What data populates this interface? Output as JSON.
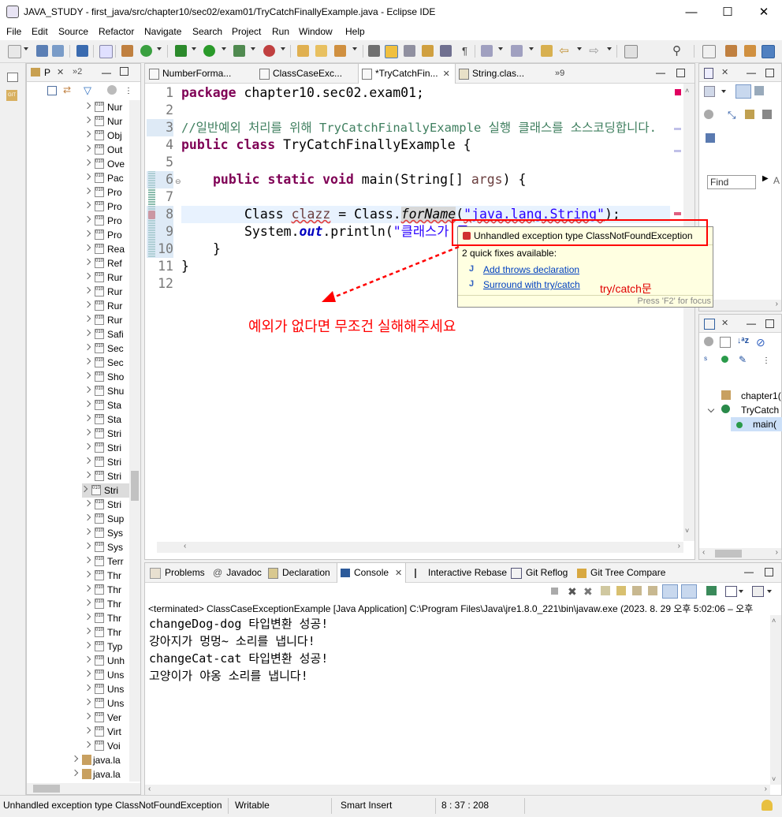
{
  "window": {
    "title": "JAVA_STUDY - first_java/src/chapter10/sec02/exam01/TryCatchFinallyExample.java - Eclipse IDE",
    "minimize": "—",
    "maximize": "☐",
    "close": "✕"
  },
  "menu": [
    "File",
    "Edit",
    "Source",
    "Refactor",
    "Navigate",
    "Search",
    "Project",
    "Run",
    "Window",
    "Help"
  ],
  "package_explorer": {
    "tab_label": "P",
    "tab2_label": "»2",
    "items": [
      "Nur",
      "Nur",
      "Obj",
      "Out",
      "Ove",
      "Pac",
      "Pro",
      "Pro",
      "Pro",
      "Pro",
      "Rea",
      "Ref",
      "Rur",
      "Rur",
      "Rur",
      "Rur",
      "Safi",
      "Sec",
      "Sec",
      "Sho",
      "Shu",
      "Sta",
      "Sta",
      "Stri",
      "Stri",
      "Stri",
      "Stri",
      "Stri",
      "Stri",
      "Sup",
      "Sys",
      "Sys",
      "Terr",
      "Thr",
      "Thr",
      "Thr",
      "Thr",
      "Thr",
      "Typ",
      "Unh",
      "Uns",
      "Uns",
      "Uns",
      "Ver",
      "Virt",
      "Voi"
    ],
    "packages": [
      "java.la",
      "java.la"
    ]
  },
  "editor": {
    "tabs": [
      "NumberForma...",
      "ClassCaseExc...",
      "*TryCatchFin...",
      "String.clas...",
      "»9"
    ],
    "active_tab": 2,
    "line_numbers": [
      "1",
      "2",
      "3",
      "4",
      "5",
      "6",
      "7",
      "8",
      "9",
      "10",
      "11",
      "12"
    ],
    "lines": {
      "l1_kw": "package",
      "l1_rest": " chapter10.sec02.exam01;",
      "l3_comment": "//일반예외 처리를 위해 TryCatchFinallyExample 실행 클래스를 소스코딩합니다.",
      "l4_kw": "public class",
      "l4_rest": " TryCatchFinallyExample {",
      "l6_kw": "public static void",
      "l6_rest1": " main(String[] ",
      "l6_var": "args",
      "l6_rest2": ") {",
      "l8_a": "Class ",
      "l8_var": "clazz",
      "l8_b": " = Class.",
      "l8_method": "forName",
      "l8_c": "(",
      "l8_str": "\"java.lang.String\"",
      "l8_d": ");",
      "l9_a": "System.",
      "l9_out": "out",
      "l9_b": ".println(",
      "l9_str": "\"클래스가 존",
      "l10": "}",
      "l11": "}"
    }
  },
  "hover_popup": {
    "title": "Unhandled exception type ClassNotFoundException",
    "subtitle": "2 quick fixes available:",
    "fixes": [
      "Add throws declaration",
      "Surround with try/catch"
    ],
    "footer": "Press 'F2' for focus"
  },
  "annotations": {
    "trycatch": "try/catch문",
    "note": "예외가 없다면 무조건 실해해주세요"
  },
  "outline": {
    "items": [
      "chapter1(",
      "TryCatch",
      "main("
    ],
    "find_placeholder": "Find",
    "all_label": "A"
  },
  "console": {
    "tabs": [
      "Problems",
      "Javadoc",
      "Declaration",
      "Console",
      "Interactive Rebase",
      "Git Reflog",
      "Git Tree Compare"
    ],
    "header": "<terminated> ClassCaseExceptionExample [Java Application] C:\\Program Files\\Java\\jre1.8.0_221\\bin\\javaw.exe  (2023. 8. 29 오후 5:02:06 – 오후",
    "lines": [
      "changeDog-dog 타입변환 성공!",
      "강아지가 멍멍~ 소리를 냅니다!",
      "changeCat-cat 타입변환 성공!",
      "고양이가 야옹 소리를 냅니다!"
    ]
  },
  "statusbar": {
    "message": "Unhandled exception type ClassNotFoundException",
    "mode": "Writable",
    "insert": "Smart Insert",
    "position": "8 : 37 : 208"
  },
  "colors": {
    "keyword": "#7f0055",
    "comment": "#3f7f5f",
    "string": "#2a00ff",
    "annotation_red": "#ff0000"
  }
}
